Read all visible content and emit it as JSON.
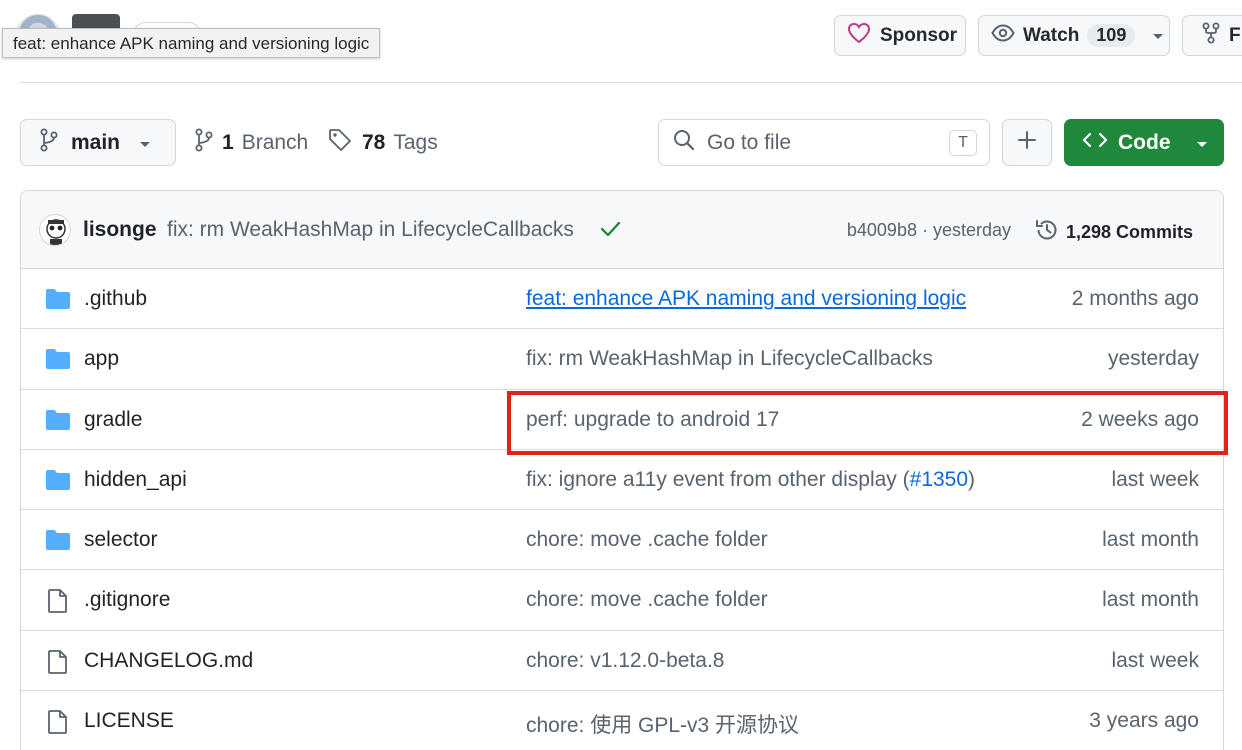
{
  "header": {
    "tooltip": "feat: enhance APK naming and versioning logic",
    "sponsor_label": "Sponsor",
    "watch_label": "Watch",
    "watch_count": "109",
    "fork_label": "F"
  },
  "toolbar": {
    "branch_name": "main",
    "branches_count": "1",
    "branches_label": "Branch",
    "tags_count": "78",
    "tags_label": "Tags",
    "goto_placeholder": "Go to file",
    "goto_shortcut": "T",
    "code_label": "Code"
  },
  "latest_commit": {
    "author": "lisonge",
    "message": "fix: rm WeakHashMap in LifecycleCallbacks",
    "sha_time": "b4009b8 · yesterday",
    "commits_count": "1,298 Commits"
  },
  "files": [
    {
      "name": ".github",
      "type": "folder",
      "message": "feat: enhance APK naming and versioning logic",
      "time": "2 months ago"
    },
    {
      "name": "app",
      "type": "folder",
      "message": "fix: rm WeakHashMap in LifecycleCallbacks",
      "time": "yesterday"
    },
    {
      "name": "gradle",
      "type": "folder",
      "message": "perf: upgrade to android 17",
      "time": "2 weeks ago"
    },
    {
      "name": "hidden_api",
      "type": "folder",
      "message": "fix: ignore a11y event from other display (",
      "message_ref": "#1350",
      "message_tail": ")",
      "time": "last week"
    },
    {
      "name": "selector",
      "type": "folder",
      "message": "chore: move .cache folder",
      "time": "last month"
    },
    {
      "name": ".gitignore",
      "type": "file",
      "message": "chore: move .cache folder",
      "time": "last month"
    },
    {
      "name": "CHANGELOG.md",
      "type": "file",
      "message": "chore: v1.12.0-beta.8",
      "time": "last week"
    },
    {
      "name": "LICENSE",
      "type": "file",
      "message": "chore: 使用 GPL-v3 开源协议",
      "time": "3 years ago"
    }
  ],
  "colors": {
    "code_button": "#1f883d",
    "folder_icon": "#54aeff",
    "link": "#0969da",
    "highlight_box": "#e3231b",
    "sponsor_heart": "#bf3989",
    "check": "#1a7f37"
  }
}
